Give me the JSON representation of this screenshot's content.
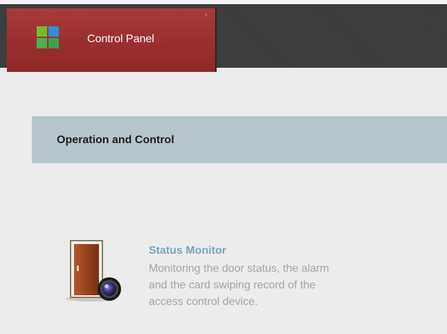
{
  "header": {
    "tab": {
      "label": "Control Panel",
      "icon": "grid-icon",
      "close_icon": "close-icon"
    },
    "colors": {
      "tab_background": "#9b2f2f",
      "bar_background": "#3a3a3a"
    }
  },
  "section": {
    "title": "Operation and Control"
  },
  "modules": [
    {
      "title": "Status Monitor",
      "icon": "door-camera-icon",
      "description_lines": [
        "Monitoring the door status, the alarm",
        "and the card swiping record of the",
        "access control device."
      ]
    }
  ],
  "colors": {
    "page_background": "#ececec",
    "section_background": "#b7c5cc",
    "module_title": "#7ba5bb",
    "module_text": "#a5a5a5"
  }
}
